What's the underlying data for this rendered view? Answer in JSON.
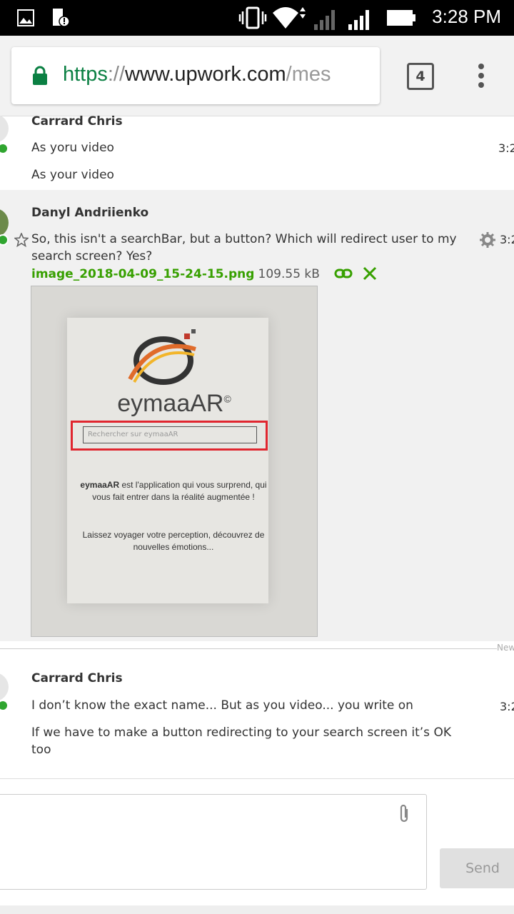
{
  "status_bar": {
    "time": "3:28 PM"
  },
  "browser": {
    "url_scheme": "https",
    "url_sep": "://",
    "url_host": "www.upwork.com",
    "url_path": "/mes",
    "tab_count": "4"
  },
  "messages": [
    {
      "author": "Carrard Chris",
      "time": "3:2",
      "lines": [
        "As yoru video",
        "As your video"
      ]
    },
    {
      "author": "Danyl Andriienko",
      "time": "3:2",
      "text": "So, this isn't a searchBar, but a button? Which will redirect user to my search screen? Yes?",
      "attachment": {
        "filename": "image_2018-04-09_15-24-15.png",
        "size": "109.55 kB",
        "image": {
          "brand": "eymaaAR",
          "brand_mark": "©",
          "search_placeholder": "Rechercher sur eymaaAR",
          "desc_bold": "eymaaAR",
          "desc_rest": "est l'application qui vous surprend, qui vous fait entrer dans la réalité augmentée !",
          "desc2": "Laissez voyager votre perception, découvrez de nouvelles émotions..."
        }
      }
    },
    {
      "author": "Carrard Chris",
      "time": "3:2",
      "lines": [
        "I don’t know the exact name... But as you video... you write on",
        "If we have to make a button redirecting to your search screen it’s OK too"
      ]
    }
  ],
  "new_label": "New",
  "composer": {
    "send_label": "Send"
  },
  "colors": {
    "accent_green": "#37a000",
    "online": "#2fa52f",
    "highlight_red": "#e0262f"
  }
}
